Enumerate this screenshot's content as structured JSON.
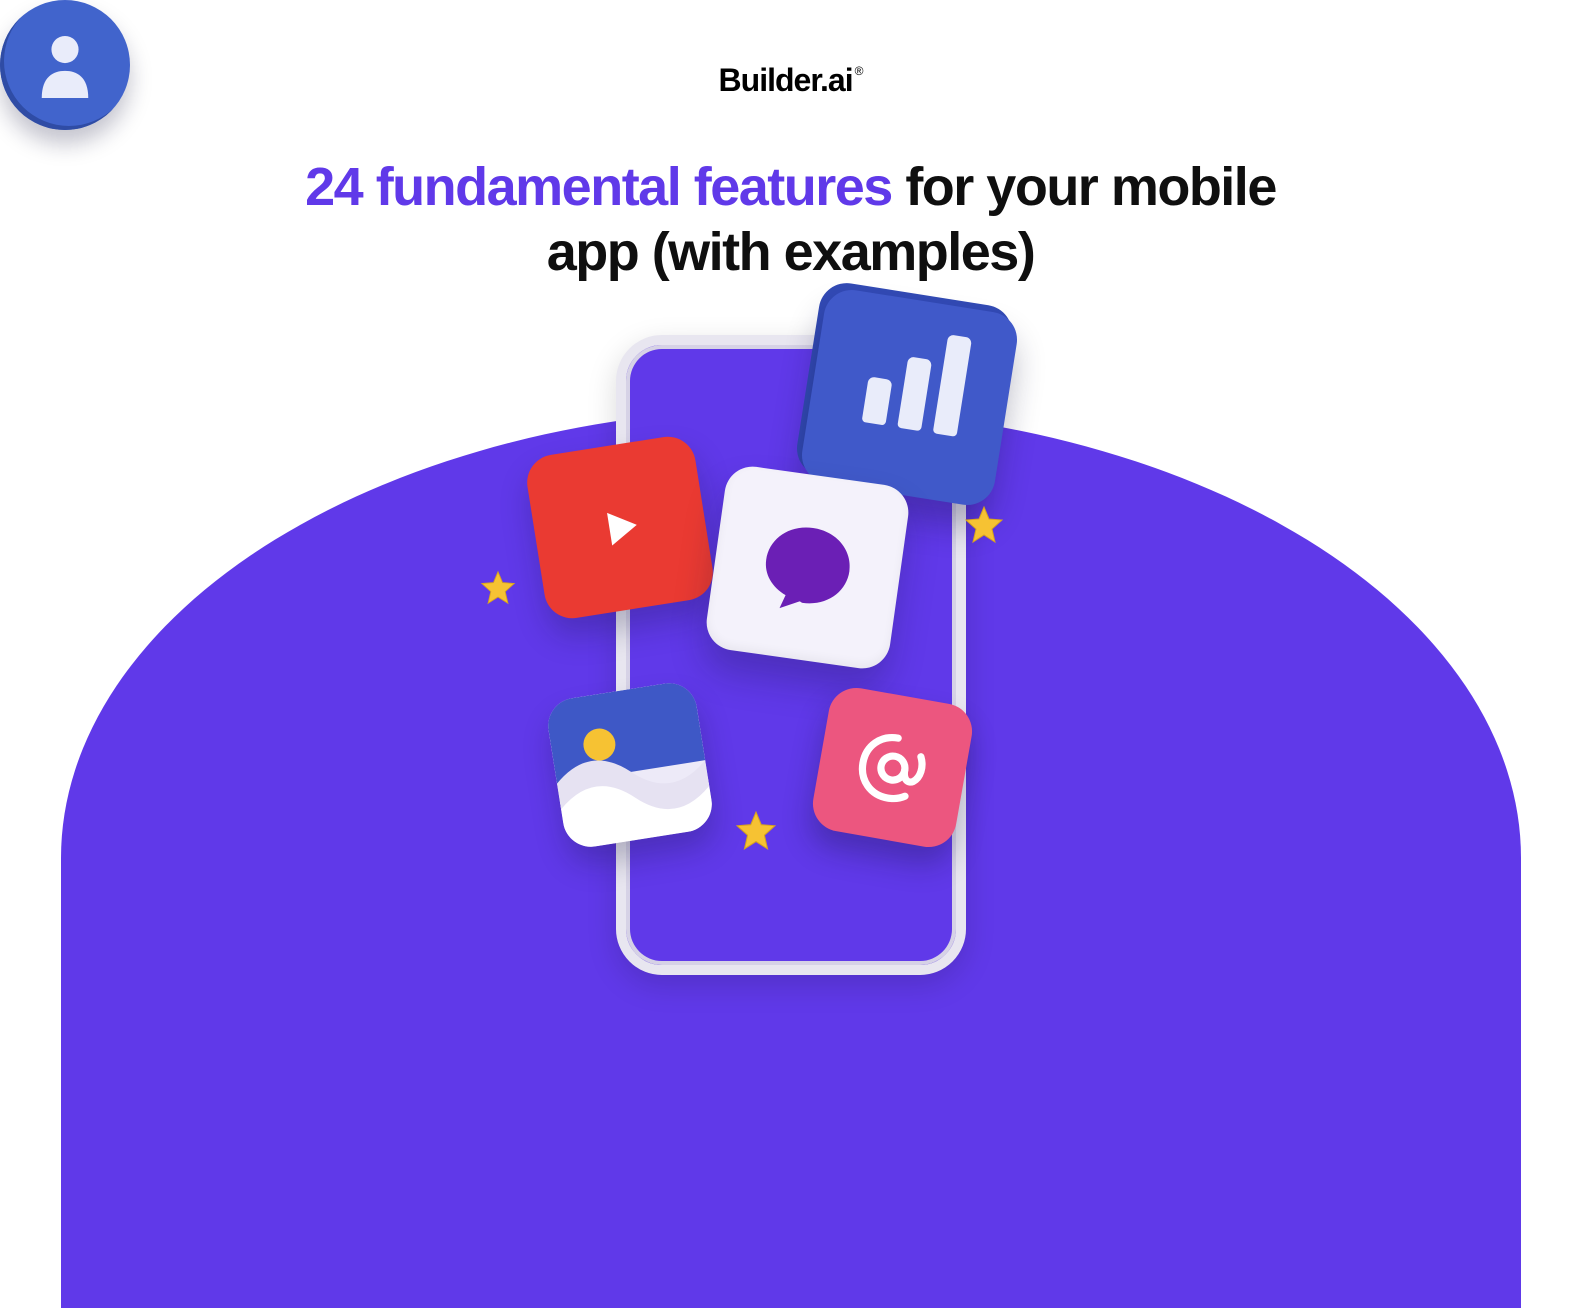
{
  "logo": {
    "text": "Builder.ai",
    "trademark": "®"
  },
  "headline": {
    "accent": "24 fundamental features",
    "rest": " for your mobile app (with examples)"
  },
  "colors": {
    "accent": "#6039e9",
    "text": "#0f0f0f",
    "red": "#ea3a32",
    "blue": "#4059c9",
    "pink": "#ec567f",
    "lilac": "#f4f2fb",
    "star": "#f6c233"
  },
  "icons": {
    "play": "play-icon",
    "chat": "chat-bubble-icon",
    "chart": "bar-chart-icon",
    "person": "person-icon",
    "gallery": "image-gallery-icon",
    "at": "at-sign-icon",
    "star": "star-icon"
  }
}
